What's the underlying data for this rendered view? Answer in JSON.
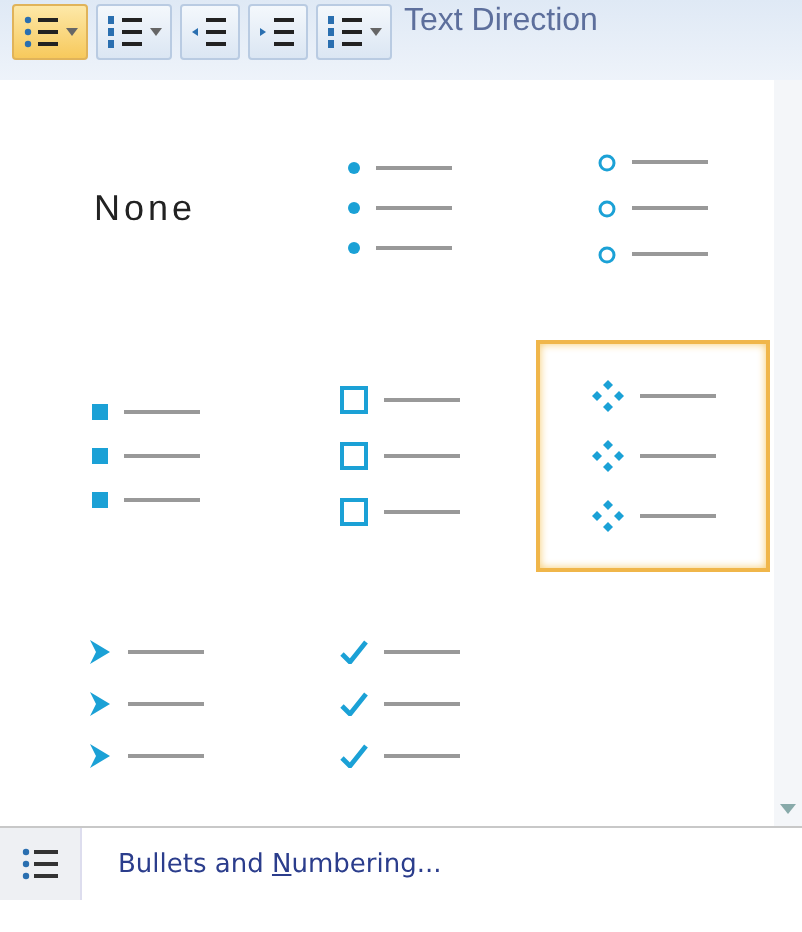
{
  "toolbar": {
    "buttons": [
      {
        "kind": "bullets",
        "selected": true,
        "has_dropdown": true
      },
      {
        "kind": "numbering",
        "selected": false,
        "has_dropdown": true
      },
      {
        "kind": "decrease-indent",
        "selected": false,
        "has_dropdown": false
      },
      {
        "kind": "increase-indent",
        "selected": false,
        "has_dropdown": false
      },
      {
        "kind": "line-spacing",
        "selected": false,
        "has_dropdown": true
      }
    ],
    "text_direction": {
      "label": "Text Direction"
    }
  },
  "gallery": {
    "items": [
      {
        "kind": "none",
        "label": "None",
        "selected": false
      },
      {
        "kind": "dot",
        "selected": false
      },
      {
        "kind": "circle",
        "selected": false
      },
      {
        "kind": "square",
        "selected": false
      },
      {
        "kind": "hollow-square",
        "selected": false
      },
      {
        "kind": "diamond-cluster",
        "selected": true
      },
      {
        "kind": "arrow",
        "selected": false
      },
      {
        "kind": "check",
        "selected": false
      }
    ]
  },
  "footer": {
    "label_parts": [
      "Bullets and ",
      "N",
      "umbering..."
    ]
  }
}
